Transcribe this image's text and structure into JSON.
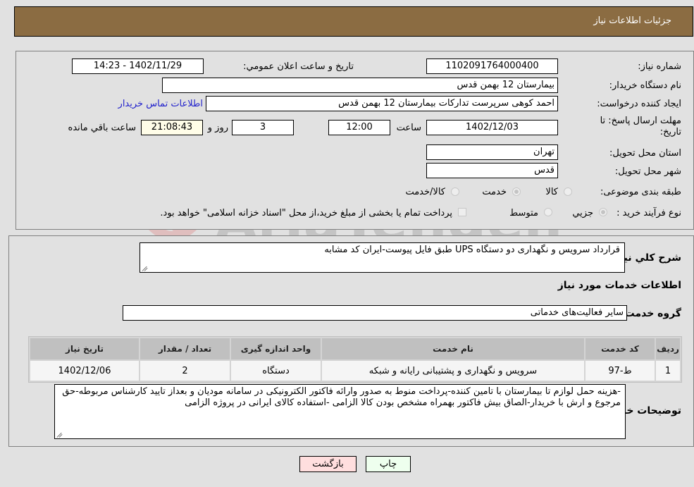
{
  "header": {
    "title": "جزئیات اطلاعات نیاز"
  },
  "form": {
    "need_number_label": "شماره نیاز:",
    "need_number": "1102091764000400",
    "announce_label": "تاریخ و ساعت اعلان عمومي:",
    "announce_value": "1402/11/29 - 14:23",
    "buyer_org_label": "نام دستگاه خریدار:",
    "buyer_org": "بیمارستان 12 بهمن قدس",
    "requester_label": "ایجاد کننده درخواست:",
    "requester": "احمد کوهی سرپرست تدارکات بیمارستان 12 بهمن قدس",
    "contact_link": "اطلاعات تماس خریدار",
    "deadline_label": "مهلت ارسال پاسخ: تا تاریخ:",
    "deadline_date": "1402/12/03",
    "time_label": "ساعت",
    "deadline_time": "12:00",
    "days_value": "3",
    "days_label": "روز و",
    "remaining_time": "21:08:43",
    "remaining_label": "ساعت باقي مانده",
    "province_label": "استان محل تحویل:",
    "province": "تهران",
    "city_label": "شهر محل تحویل:",
    "city": "قدس",
    "category_label": "طبقه بندی موضوعی:",
    "category_options": [
      {
        "label": "کالا",
        "checked": false
      },
      {
        "label": "خدمت",
        "checked": true
      },
      {
        "label": "کالا/خدمت",
        "checked": false
      }
    ],
    "process_label": "نوع فرآیند خرید :",
    "process_options": [
      {
        "label": "جزيي",
        "checked": true
      },
      {
        "label": "متوسط",
        "checked": false
      }
    ],
    "treasury_note": "پرداخت تمام یا بخشی از مبلغ خرید،از محل \"اسناد خزانه اسلامی\" خواهد بود."
  },
  "details": {
    "summary_label": "شرح کلي نیاز:",
    "summary": "قرارداد سرویس و نگهداری دو دستگاه UPS طبق فایل پیوست-ایران کد مشابه",
    "services_title": "اطلاعات خدمات مورد نیاز",
    "service_group_label": "گروه خدمت:",
    "service_group": "سایر فعالیت‌های خدماتی",
    "table": {
      "headers": [
        "ردیف",
        "کد خدمت",
        "نام خدمت",
        "واحد اندازه گیری",
        "تعداد / مقدار",
        "تاریخ نیاز"
      ],
      "rows": [
        [
          "1",
          "ط-97",
          "سرویس و نگهداری و پشتیبانی رایانه و شبکه",
          "دستگاه",
          "2",
          "1402/12/06"
        ]
      ]
    },
    "buyer_notes_label": "توضیحات خریدار:",
    "buyer_notes": "-هزینه حمل لوازم تا بیمارستان با تامین کننده-پرداخت منوط به صدور وارائه فاکتور الکترونیکی  در سامانه مودیان و  بعداز تایید کارشناس مربوطه-حق مرجوع و ارش با خریدار-الصاق بیش فاکتور بهمراه مشخص بودن  کالا الزامی -استفاده کالای ایرانی در پروژه الزامی"
  },
  "buttons": {
    "back": "بازگشت",
    "print": "چاپ"
  },
  "watermark": {
    "text": "AriaTender.neT"
  }
}
